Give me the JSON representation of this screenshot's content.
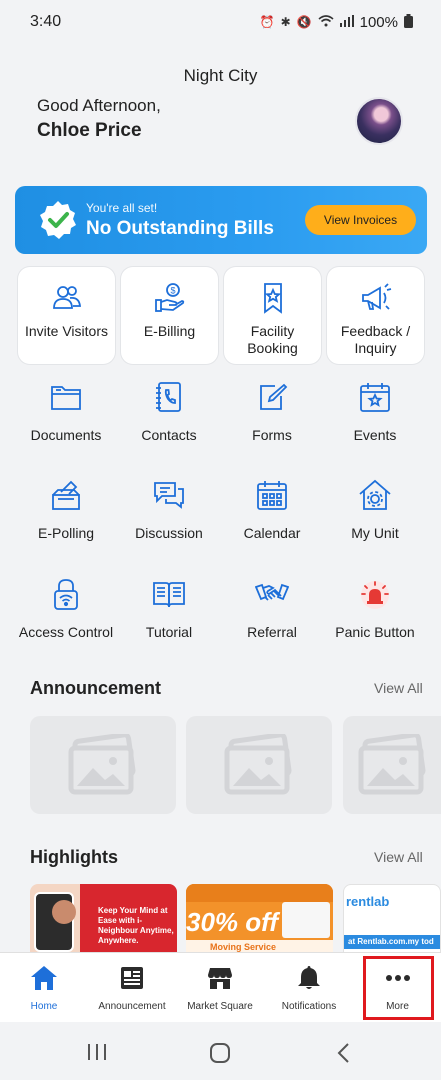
{
  "status_bar": {
    "time": "3:40",
    "battery": "100%"
  },
  "header": {
    "city": "Night City",
    "greeting": "Good Afternoon,",
    "user_name": "Chloe Price"
  },
  "banner": {
    "subtitle": "You're all set!",
    "title": "No Outstanding Bills",
    "button": "View Invoices"
  },
  "quick_cards": [
    {
      "label": "Invite Visitors",
      "icon": "people-icon"
    },
    {
      "label": "E-Billing",
      "icon": "hand-coin-icon"
    },
    {
      "label": "Facility Booking",
      "icon": "bookmark-star-icon"
    },
    {
      "label": "Feedback / Inquiry",
      "icon": "megaphone-icon"
    }
  ],
  "menu_tiles": [
    {
      "label": "Documents",
      "icon": "folder-icon"
    },
    {
      "label": "Contacts",
      "icon": "phone-book-icon"
    },
    {
      "label": "Forms",
      "icon": "edit-form-icon"
    },
    {
      "label": "Events",
      "icon": "calendar-star-icon"
    },
    {
      "label": "E-Polling",
      "icon": "ballot-box-icon"
    },
    {
      "label": "Discussion",
      "icon": "chat-bubbles-icon"
    },
    {
      "label": "Calendar",
      "icon": "calendar-grid-icon"
    },
    {
      "label": "My Unit",
      "icon": "house-gear-icon"
    },
    {
      "label": "Access Control",
      "icon": "lock-wifi-icon"
    },
    {
      "label": "Tutorial",
      "icon": "open-book-icon"
    },
    {
      "label": "Referral",
      "icon": "handshake-icon"
    },
    {
      "label": "Panic Button",
      "icon": "siren-icon"
    }
  ],
  "announcement": {
    "title": "Announcement",
    "view_all": "View All"
  },
  "highlights": {
    "title": "Highlights",
    "view_all": "View All",
    "cards": [
      {
        "headline": "Keep Your Mind at Ease with i-Neighbour Anytime, Anywhere."
      },
      {
        "headline": "30% off",
        "sub": "Moving Service"
      },
      {
        "brand": "rentlab",
        "text": "at Rentlab.com.my tod"
      }
    ]
  },
  "bottom_nav": [
    {
      "label": "Home",
      "icon": "home-icon",
      "active": true
    },
    {
      "label": "Announcement",
      "icon": "newspaper-icon"
    },
    {
      "label": "Market Square",
      "icon": "store-icon"
    },
    {
      "label": "Notifications",
      "icon": "bell-icon"
    },
    {
      "label": "More",
      "icon": "more-dots-icon"
    }
  ],
  "colors": {
    "primary": "#1e6fd9",
    "banner": "#2b9cf0",
    "accent": "#ffae1a",
    "highlight_box": "#e0191e"
  }
}
